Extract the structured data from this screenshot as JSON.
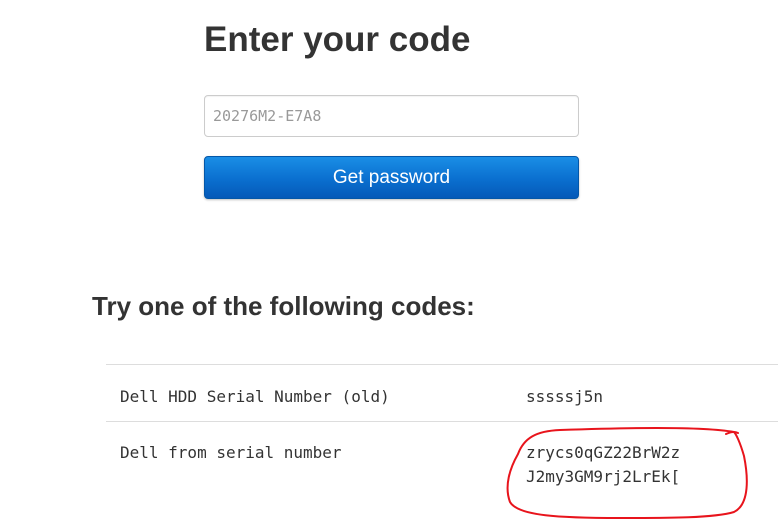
{
  "page": {
    "heading": "Enter your code",
    "input": {
      "placeholder": "20276M2-E7A8",
      "value": ""
    },
    "submit_label": "Get password",
    "codes_heading": "Try one of the following codes:"
  },
  "codes_table": {
    "rows": [
      {
        "label": "Dell HDD Serial Number (old)",
        "code_lines": [
          "sssssj5n"
        ]
      },
      {
        "label": "Dell from serial number",
        "code_lines": [
          "zrycs0qGZ22BrW2z",
          "J2my3GM9rj2LrEk["
        ]
      }
    ]
  },
  "annotation": {
    "color": "#e8141c",
    "shape": "freehand-circle"
  }
}
